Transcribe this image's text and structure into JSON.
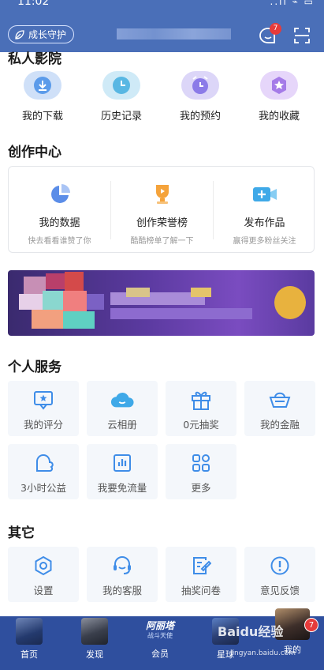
{
  "status": {
    "time": "11:02",
    "right": "..ıl ⌁ ▭"
  },
  "header": {
    "growth_label": "成长守护",
    "msg_badge": "7"
  },
  "cinema": {
    "title": "私人影院",
    "items": [
      {
        "label": "我的下载",
        "icon": "download-icon"
      },
      {
        "label": "历史记录",
        "icon": "clock-icon"
      },
      {
        "label": "我的预约",
        "icon": "alarm-icon"
      },
      {
        "label": "我的收藏",
        "icon": "star-icon"
      }
    ]
  },
  "create": {
    "title": "创作中心",
    "items": [
      {
        "label": "我的数据",
        "sub": "快去看看谁赞了你",
        "icon": "pie-chart-icon"
      },
      {
        "label": "创作荣誉榜",
        "sub": "酷酷榜单了解一下",
        "icon": "trophy-icon"
      },
      {
        "label": "发布作品",
        "sub": "赢得更多粉丝关注",
        "icon": "camera-add-icon"
      }
    ]
  },
  "services": {
    "title": "个人服务",
    "items": [
      {
        "label": "我的评分",
        "icon": "rating-icon"
      },
      {
        "label": "云相册",
        "icon": "cloud-icon"
      },
      {
        "label": "0元抽奖",
        "icon": "gift-icon"
      },
      {
        "label": "我的金融",
        "icon": "ingot-icon"
      },
      {
        "label": "3小时公益",
        "icon": "charity-icon"
      },
      {
        "label": "我要免流量",
        "icon": "data-icon"
      },
      {
        "label": "更多",
        "icon": "grid-icon"
      }
    ]
  },
  "other": {
    "title": "其它",
    "items": [
      {
        "label": "设置",
        "icon": "settings-icon"
      },
      {
        "label": "我的客服",
        "icon": "support-icon"
      },
      {
        "label": "抽奖问卷",
        "icon": "survey-icon"
      },
      {
        "label": "意见反馈",
        "icon": "feedback-icon"
      }
    ]
  },
  "nav": {
    "items": [
      {
        "label": "首页"
      },
      {
        "label": "发现"
      },
      {
        "label": "会员",
        "logo": "阿丽塔",
        "logo_sub": "战斗天使"
      },
      {
        "label": "星球"
      },
      {
        "label": "我的",
        "badge": "7"
      }
    ]
  },
  "watermark": {
    "brand": "Baidu经验",
    "url": "jingyan.baidu.com"
  },
  "colors": {
    "header": "#4a6fb8",
    "nav": "#2f4f9e",
    "accent": "#4a90e2"
  }
}
